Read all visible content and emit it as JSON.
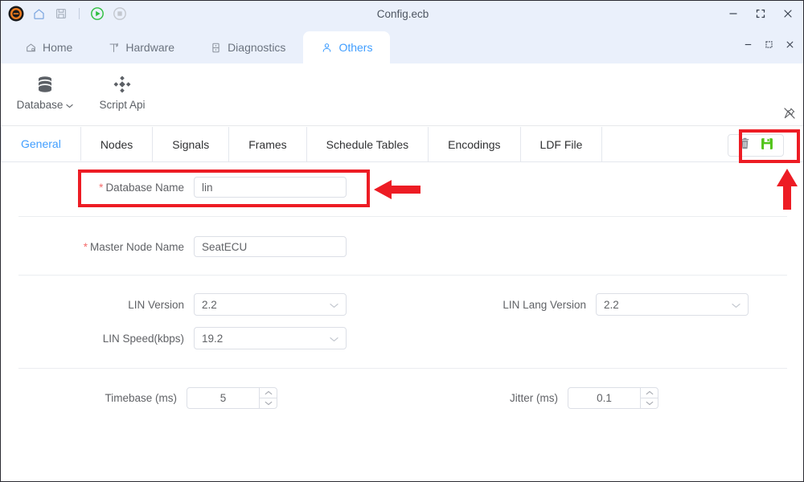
{
  "window": {
    "title": "Config.ecb",
    "controls": [
      {
        "name": "minimize",
        "glyph": "–"
      },
      {
        "name": "maximize",
        "glyph": "[ ]"
      },
      {
        "name": "close",
        "glyph": "×"
      }
    ]
  },
  "quick_access": {
    "app_icon": "app-logo-icon",
    "buttons": [
      {
        "name": "home-icon",
        "label": "Home"
      },
      {
        "name": "save-icon",
        "label": "Save"
      },
      {
        "name": "run-icon",
        "label": "Run"
      },
      {
        "name": "stop-icon",
        "label": "Stop"
      }
    ]
  },
  "main_tabs": [
    {
      "label": "Home",
      "icon": "home-outline-icon",
      "active": false
    },
    {
      "label": "Hardware",
      "icon": "hardware-icon",
      "active": false
    },
    {
      "label": "Diagnostics",
      "icon": "diagnostics-icon",
      "active": false
    },
    {
      "label": "Others",
      "icon": "user-icon",
      "active": true
    }
  ],
  "inner_window_controls": [
    {
      "name": "minimize",
      "glyph": "–"
    },
    {
      "name": "restore",
      "glyph": "▢"
    },
    {
      "name": "close",
      "glyph": "×"
    }
  ],
  "ribbon": {
    "items": [
      {
        "label": "Database",
        "icon": "database-icon",
        "has_dropdown": true,
        "caret": "⌄"
      },
      {
        "label": "Script Api",
        "icon": "script-api-icon",
        "has_dropdown": false,
        "caret": ""
      }
    ],
    "pin_icon": "unpin-icon"
  },
  "sub_tabs": [
    {
      "label": "General",
      "active": true
    },
    {
      "label": "Nodes",
      "active": false
    },
    {
      "label": "Signals",
      "active": false
    },
    {
      "label": "Frames",
      "active": false
    },
    {
      "label": "Schedule Tables",
      "active": false
    },
    {
      "label": "Encodings",
      "active": false
    },
    {
      "label": "LDF File",
      "active": false
    }
  ],
  "tab_actions": [
    {
      "name": "delete-button",
      "icon": "trash-icon",
      "color": "#8d9199"
    },
    {
      "name": "save-button",
      "icon": "save-floppy-icon",
      "color": "#52c41a"
    }
  ],
  "form": {
    "database_name": {
      "label": "Database Name",
      "required": true,
      "required_marker": "*",
      "value": "lin",
      "placeholder": ""
    },
    "master_node_name": {
      "label": "Master Node Name",
      "required": true,
      "required_marker": "*",
      "value": "SeatECU",
      "placeholder": ""
    },
    "lin_version": {
      "label": "LIN Version",
      "value": "2.2",
      "chevron": "⌄"
    },
    "lin_lang_version": {
      "label": "LIN Lang Version",
      "value": "2.2",
      "chevron": "⌄"
    },
    "lin_speed": {
      "label": "LIN Speed(kbps)",
      "value": "19.2",
      "chevron": "⌄"
    },
    "timebase": {
      "label": "Timebase (ms)",
      "value": "5",
      "up": "∧",
      "down": "∨"
    },
    "jitter": {
      "label": "Jitter (ms)",
      "value": "0.1",
      "up": "∧",
      "down": "∨"
    }
  },
  "annotations": {
    "color": "#ed1c24",
    "highlight_database_name": true,
    "highlight_save_actions": true,
    "arrow_to_database_name": "left-arrow",
    "arrow_to_save": "up-arrow"
  }
}
